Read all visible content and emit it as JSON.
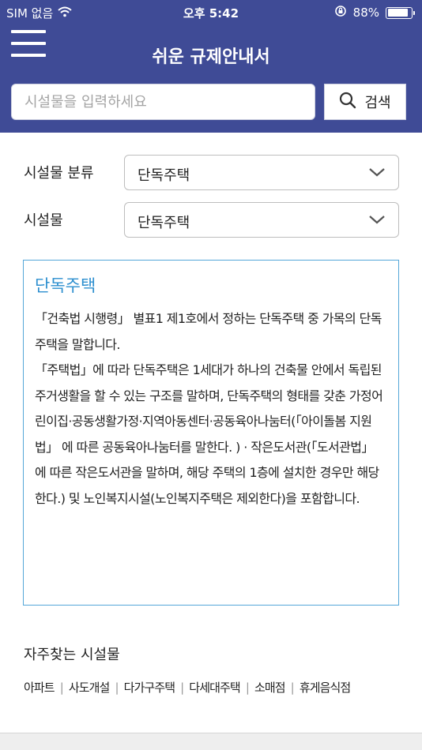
{
  "status_bar": {
    "carrier": "SIM 없음",
    "time": "오후 5:42",
    "battery_text": "88%",
    "battery_level": 0.88
  },
  "header": {
    "title": "쉬운 규제안내서"
  },
  "search": {
    "placeholder": "시설물을 입력하세요",
    "value": "",
    "button_label": "검색"
  },
  "filters": {
    "category_label": "시설물 분류",
    "category_value": "단독주택",
    "facility_label": "시설물",
    "facility_value": "단독주택"
  },
  "info": {
    "title": "단독주택",
    "body": "「건축법 시행령」 별표1 제1호에서 정하는 단독주택 중 가목의 단독주택을 말합니다.\n「주택법」에 따라 단독주택은 1세대가 하나의 건축물 안에서 독립된 주거생활을 할 수 있는 구조를 말하며, 단독주택의 형태를 갖춘 가정어린이집·공동생활가정·지역아동센터·공동육아나눔터(「아이돌봄 지원법」 에 따른 공동육아나눔터를 말한다. ) · 작은도서관(「도서관법」 에 따른 작은도서관을 말하며, 해당 주택의 1층에 설치한 경우만 해당한다.) 및 노인복지시설(노인복지주택은 제외한다)을 포함합니다."
  },
  "frequent": {
    "title": "자주찾는 시설물",
    "items": [
      "아파트",
      "사도개설",
      "다가구주택",
      "다세대주택",
      "소매점",
      "휴게음식점"
    ]
  },
  "icons": {
    "menu": "hamburger-menu-icon",
    "search": "search-icon",
    "dropdown": "chevron-down-icon",
    "wifi": "wifi-icon",
    "lock": "orientation-lock-icon",
    "battery": "battery-icon"
  },
  "colors": {
    "brand": "#3f4b96",
    "accent": "#2d8fcf",
    "border": "#55a7d8"
  }
}
